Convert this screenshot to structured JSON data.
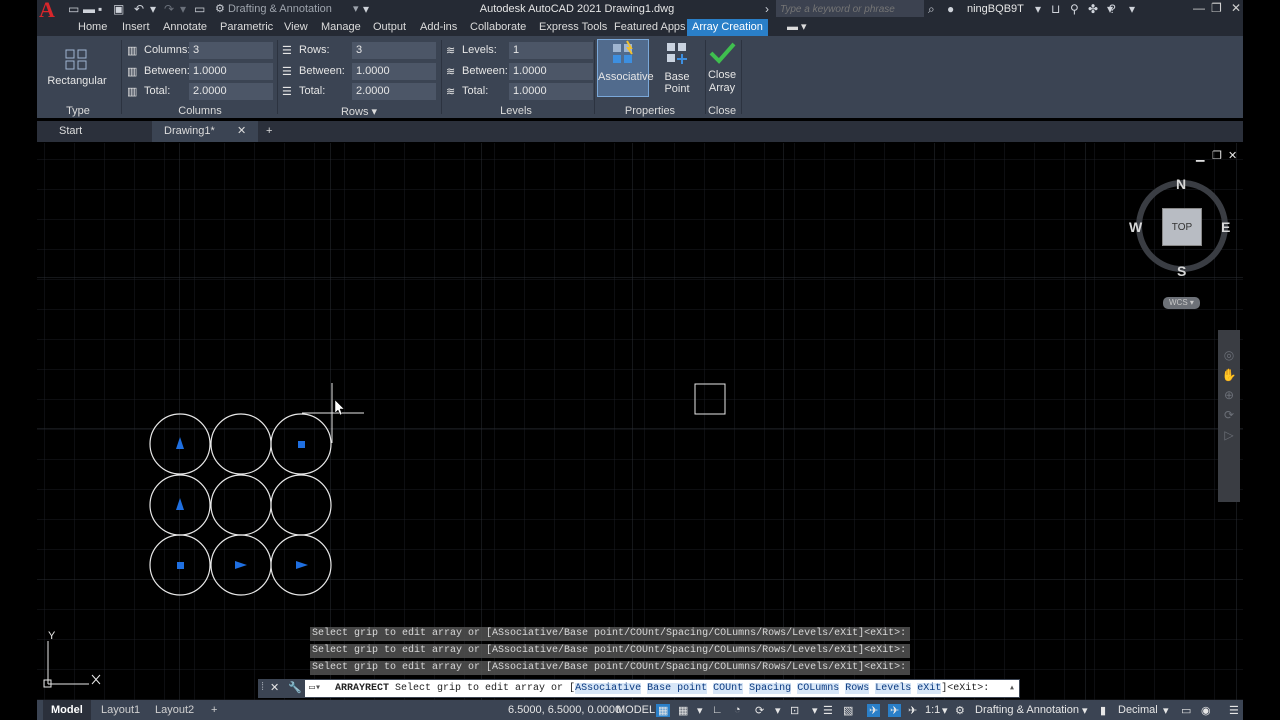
{
  "title_bar": {
    "workspace": "Drafting & Annotation",
    "title": "Autodesk AutoCAD 2021   Drawing1.dwg",
    "search_placeholder": "Type a keyword or phrase",
    "user": "ningBQB9T"
  },
  "ribbon_tabs": [
    "Home",
    "Insert",
    "Annotate",
    "Parametric",
    "View",
    "Manage",
    "Output",
    "Add-ins",
    "Collaborate",
    "Express Tools",
    "Featured Apps",
    "Array Creation"
  ],
  "ribbon": {
    "type_button": "Rectangular",
    "type_group": "Type",
    "columns": {
      "group": "Columns",
      "count_label": "Columns:",
      "count_value": "3",
      "between_label": "Between:",
      "between_value": "1.0000",
      "total_label": "Total:",
      "total_value": "2.0000"
    },
    "rows": {
      "group": "Rows",
      "count_label": "Rows:",
      "count_value": "3",
      "between_label": "Between:",
      "between_value": "1.0000",
      "total_label": "Total:",
      "total_value": "2.0000"
    },
    "levels": {
      "group": "Levels",
      "count_label": "Levels:",
      "count_value": "1",
      "between_label": "Between:",
      "between_value": "1.0000",
      "total_label": "Total:",
      "total_value": "1.0000"
    },
    "associative_label": "Associative",
    "base_point_label": "Base Point",
    "properties_group": "Properties",
    "close_label_1": "Close",
    "close_label_2": "Array",
    "close_group": "Close"
  },
  "file_tabs": {
    "start": "Start",
    "drawing": "Drawing1*"
  },
  "viewcube": {
    "north": "N",
    "south": "S",
    "east": "E",
    "west": "W",
    "face": "TOP",
    "ucs": "WCS"
  },
  "ucs_icon": {
    "y": "Y"
  },
  "command_history": [
    "Select grip to edit array or [ASsociative/Base point/COUnt/Spacing/COLumns/Rows/Levels/eXit]<eXit>:",
    "Select grip to edit array or [ASsociative/Base point/COUnt/Spacing/COLumns/Rows/Levels/eXit]<eXit>:",
    "Select grip to edit array or [ASsociative/Base point/COUnt/Spacing/COLumns/Rows/Levels/eXit]<eXit>:"
  ],
  "command_line": {
    "command": "ARRAYRECT",
    "prompt": "Select grip to edit array or [",
    "opt_associative": "ASsociative",
    "opt_basepoint": "Base point",
    "opt_count": "COUnt",
    "opt_spacing": "Spacing",
    "opt_columns": "COLumns",
    "opt_rows": "Rows",
    "opt_levels": "Levels",
    "opt_exit": "eXit",
    "suffix": "]<eXit>:"
  },
  "status_bar": {
    "tabs": [
      "Model",
      "Layout1",
      "Layout2"
    ],
    "coordinates": "6.5000, 6.5000, 0.0000",
    "space": "MODEL",
    "scale": "1:1",
    "workspace": "Drafting & Annotation",
    "units": "Decimal"
  },
  "colors": {
    "ribbon_bg": "#3b4453",
    "accent": "#2a7fc8",
    "grip": "#1f6fe0",
    "drawing_bg": "#000000"
  }
}
